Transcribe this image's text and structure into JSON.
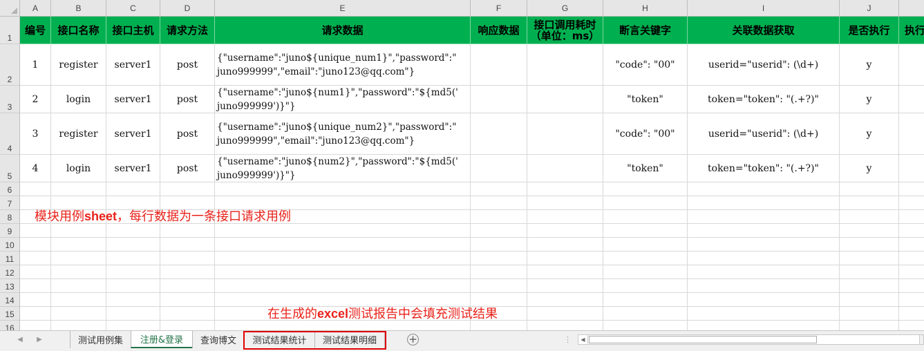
{
  "columns": [
    "A",
    "B",
    "C",
    "D",
    "E",
    "F",
    "G",
    "H",
    "I",
    "J"
  ],
  "row_numbers": [
    "1",
    "2",
    "3",
    "4",
    "5",
    "6",
    "7",
    "8",
    "9",
    "10",
    "11",
    "12",
    "13",
    "14",
    "15",
    "16"
  ],
  "headers": {
    "a": "编号",
    "b": "接口名称",
    "c": "接口主机",
    "d": "请求方法",
    "e": "请求数据",
    "f": "响应数据",
    "g": "接口调用耗时\n（单位：ms）",
    "h": "断言关键字",
    "i": "关联数据获取",
    "j": "是否执行",
    "k": "执行"
  },
  "rows": [
    {
      "a": "1",
      "b": "register",
      "c": "server1",
      "d": "post",
      "e": "{\"username\":\"juno${unique_num1}\",\"password\":\"\njuno999999\",\"email\":\"juno123@qq.com\"}",
      "f": "",
      "g": "",
      "h": "\"code\": \"00\"",
      "i": "userid=\"userid\": (\\d+)",
      "j": "y"
    },
    {
      "a": "2",
      "b": "login",
      "c": "server1",
      "d": "post",
      "e": "{\"username\":\"juno${num1}\",\"password\":\"${md5('\njuno999999')}\"}",
      "f": "",
      "g": "",
      "h": "\"token\"",
      "i": "token=\"token\": \"(.+?)\"",
      "j": "y"
    },
    {
      "a": "3",
      "b": "register",
      "c": "server1",
      "d": "post",
      "e": "{\"username\":\"juno${unique_num2}\",\"password\":\"\njuno999999\",\"email\":\"juno123@qq.com\"}",
      "f": "",
      "g": "",
      "h": "\"code\": \"00\"",
      "i": "userid=\"userid\": (\\d+)",
      "j": "y"
    },
    {
      "a": "4",
      "b": "login",
      "c": "server1",
      "d": "post",
      "e": "{\"username\":\"juno${num2}\",\"password\":\"${md5('\njuno999999')}\"}",
      "f": "",
      "g": "",
      "h": "\"token\"",
      "i": "token=\"token\": \"(.+?)\"",
      "j": "y"
    }
  ],
  "annotations": {
    "note1_prefix": "模块用例",
    "note1_bold": "sheet",
    "note1_suffix": "，每行数据为一条接口请求用例",
    "note2_prefix": "在生成的",
    "note2_bold": "excel",
    "note2_suffix": "测试报告中会填充测试结果"
  },
  "tabs": [
    {
      "label": "测试用例集",
      "active": false
    },
    {
      "label": "注册&登录",
      "active": true
    },
    {
      "label": "查询博文",
      "active": false
    },
    {
      "label": "测试结果统计",
      "active": false
    },
    {
      "label": "测试结果明细",
      "active": false
    }
  ],
  "icons": {
    "prev": "chevron-left-icon",
    "next": "chevron-right-icon",
    "add": "plus-circle-icon",
    "split": "vertical-dots-icon"
  },
  "colors": {
    "header_fill": "#00b050",
    "annotation_text": "#e8221a",
    "highlight_box": "#e00000",
    "active_tab": "#217346"
  }
}
